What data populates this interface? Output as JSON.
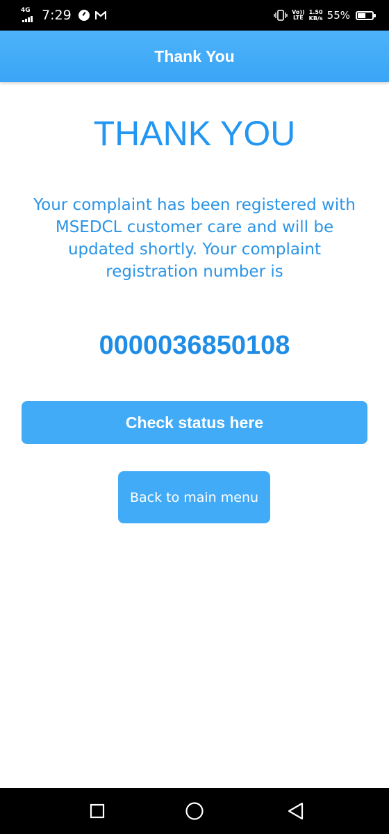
{
  "status_bar": {
    "network": "4G",
    "time": "7:29",
    "volte_top": "Vo))",
    "volte_bottom": "LTE",
    "speed_value": "1.50",
    "speed_unit": "KB/s",
    "battery_percent": "55%",
    "battery_level": 0.55,
    "icons": [
      "signal-icon",
      "speed-dial-icon",
      "mail-icon",
      "vibrate-icon",
      "battery-icon"
    ]
  },
  "app_bar": {
    "title": "Thank You"
  },
  "main": {
    "heading": "THANK YOU",
    "message": "Your complaint has been registered with MSEDCL customer care and will be updated shortly. Your complaint registration number is",
    "registration_number": "0000036850108",
    "check_status_label": "Check status here",
    "back_label": "Back to main menu"
  },
  "nav_bar": {
    "icons": [
      "recents-icon",
      "home-icon",
      "back-icon"
    ]
  },
  "colors": {
    "accent": "#2196f3",
    "button": "#42abf7",
    "app_bar": "#3aa5f5"
  }
}
